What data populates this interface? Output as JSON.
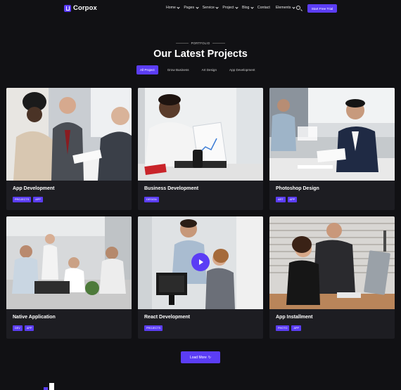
{
  "header": {
    "logo_text": "Corpox",
    "nav": [
      {
        "label": "Home",
        "dropdown": true
      },
      {
        "label": "Pages",
        "dropdown": true
      },
      {
        "label": "Service",
        "dropdown": true
      },
      {
        "label": "Project",
        "dropdown": true
      },
      {
        "label": "Blog",
        "dropdown": true
      },
      {
        "label": "Contact",
        "dropdown": false
      },
      {
        "label": "Elements",
        "dropdown": true
      }
    ],
    "cta_label": "Start Free Trial"
  },
  "section": {
    "eyebrow": "PORTFOLIO",
    "title": "Our Latest Projects",
    "filters": [
      "All Project",
      "Grow Business",
      "Art Design",
      "App Development"
    ],
    "active_filter": "All Project"
  },
  "cards": [
    {
      "title": "App Development",
      "tags": [
        "PROJECTS",
        "APP"
      ]
    },
    {
      "title": "Business Development",
      "tags": [
        "DESIGN"
      ]
    },
    {
      "title": "Photoshop Design",
      "tags": [
        "ART",
        "APP"
      ]
    },
    {
      "title": "Native Application",
      "tags": [
        "DEV",
        "APP"
      ]
    },
    {
      "title": "React Development",
      "tags": [
        "PROJECTS"
      ]
    },
    {
      "title": "App Installment",
      "tags": [
        "PHOTO",
        "APP"
      ]
    }
  ],
  "load_more_label": "Load More",
  "colors": {
    "accent": "#5b3df5",
    "background": "#111114",
    "card": "#1d1d22"
  }
}
